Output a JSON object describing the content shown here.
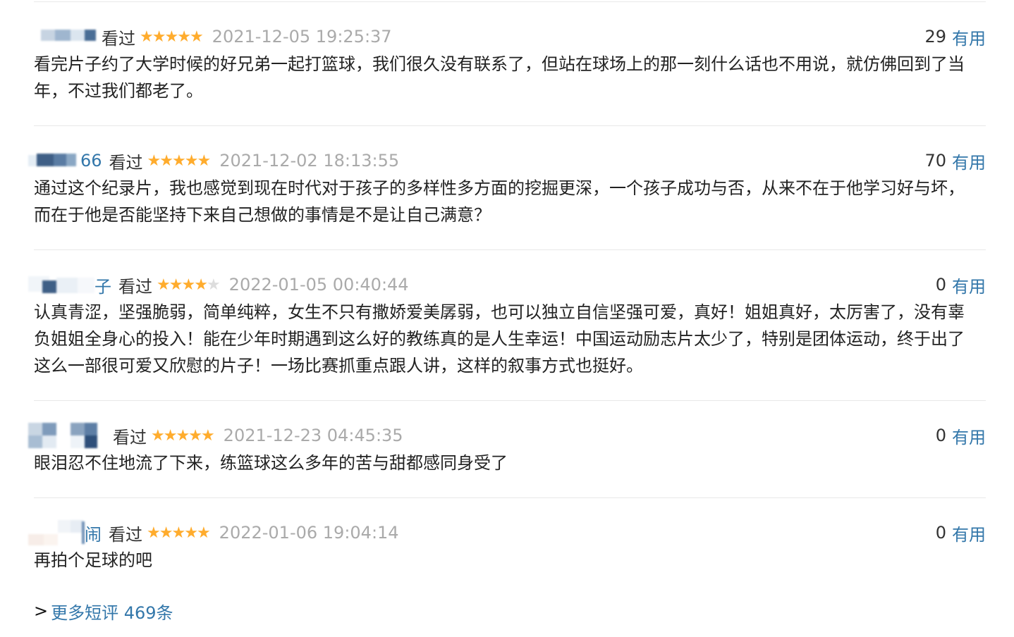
{
  "comments": [
    {
      "user_tail": "",
      "watched": "看过",
      "rating": 5,
      "time": "2021-12-05 19:25:37",
      "votes": "29",
      "useful": "有用",
      "text": "看完片子约了大学时候的好兄弟一起打篮球，我们很久没有联系了，但站在球场上的那一刻什么话也不用说，就仿佛回到了当年，不过我们都老了。"
    },
    {
      "user_tail": "66",
      "watched": "看过",
      "rating": 5,
      "time": "2021-12-02 18:13:55",
      "votes": "70",
      "useful": "有用",
      "text": "通过这个纪录片，我也感觉到现在时代对于孩子的多样性多方面的挖掘更深，一个孩子成功与否，从来不在于他学习好与坏，而在于他是否能坚持下来自己想做的事情是不是让自己满意？"
    },
    {
      "user_tail": "子",
      "watched": "看过",
      "rating": 4,
      "time": "2022-01-05 00:40:44",
      "votes": "0",
      "useful": "有用",
      "text": "认真青涩，坚强脆弱，简单纯粹，女生不只有撒娇爱美孱弱，也可以独立自信坚强可爱，真好！姐姐真好，太厉害了，没有辜负姐姐全身心的投入！能在少年时期遇到这么好的教练真的是人生幸运！中国运动励志片太少了，特别是团体运动，终于出了这么一部很可爱又欣慰的片子！一场比赛抓重点跟人讲，这样的叙事方式也挺好。"
    },
    {
      "user_tail": "",
      "watched": "看过",
      "rating": 5,
      "time": "2021-12-23 04:45:35",
      "votes": "0",
      "useful": "有用",
      "text": "眼泪忍不住地流了下来，练篮球这么多年的苦与甜都感同身受了"
    },
    {
      "user_tail": "闹",
      "watched": "看过",
      "rating": 5,
      "time": "2022-01-06 19:04:14",
      "votes": "0",
      "useful": "有用",
      "text": "再拍个足球的吧"
    }
  ],
  "more": {
    "arrow": ">",
    "label": "更多短评 469条"
  },
  "colors": {
    "link": "#3377aa",
    "star": "#ffac2d",
    "star_empty": "#dddddd",
    "time": "#aaaaaa"
  }
}
